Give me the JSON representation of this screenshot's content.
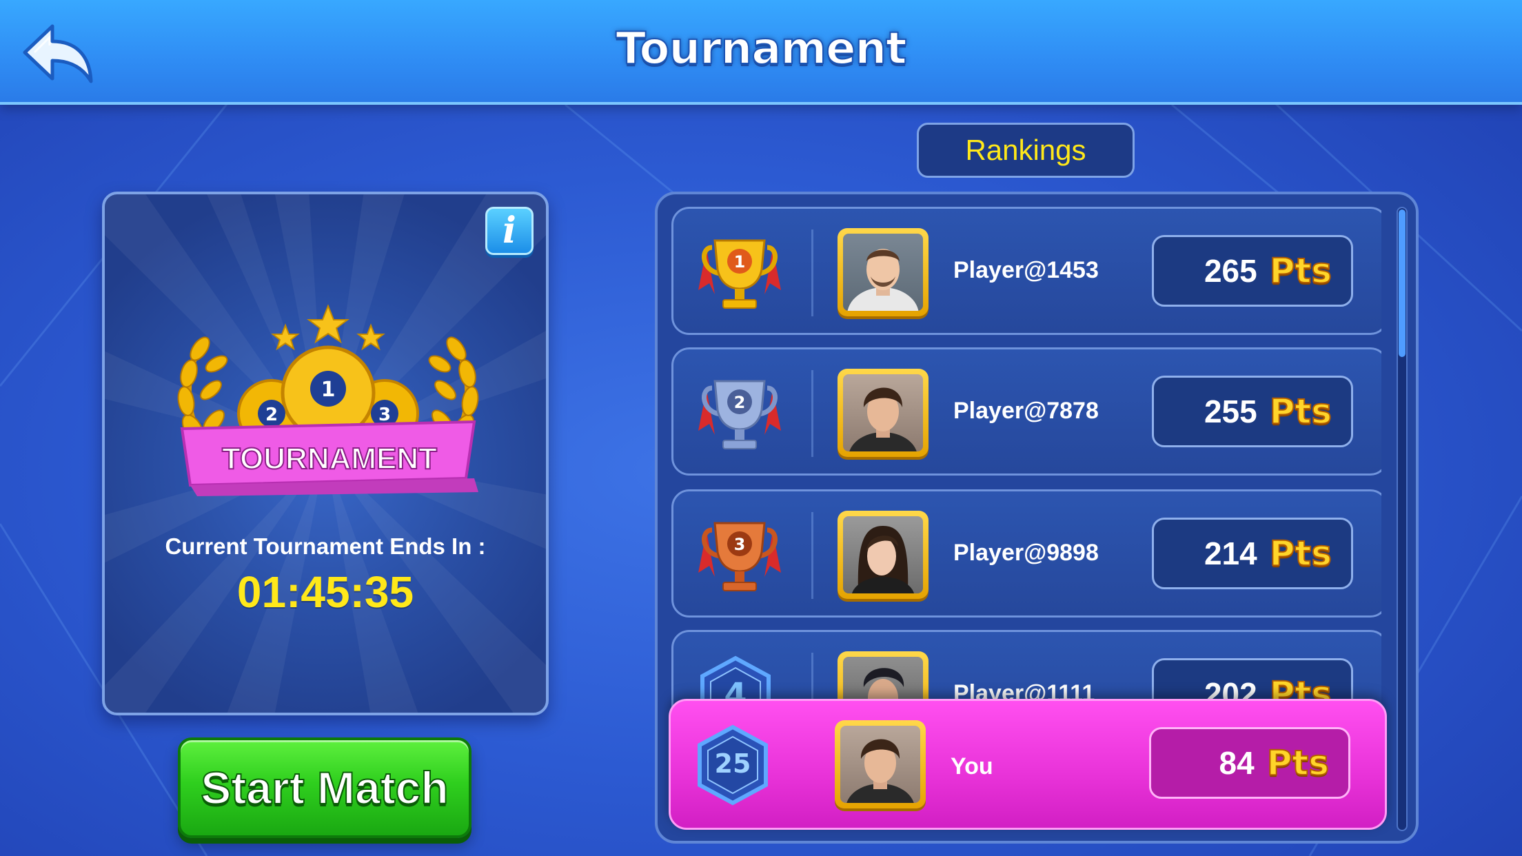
{
  "header": {
    "title": "Tournament"
  },
  "left_panel": {
    "emblem": {
      "medal_numbers": [
        "2",
        "1",
        "3"
      ],
      "banner_text": "TOURNAMENT"
    },
    "ends_label": "Current Tournament Ends In :",
    "timer": "01:45:35"
  },
  "start_button": {
    "label": "Start Match"
  },
  "rankings": {
    "tab_label": "Rankings",
    "rows": [
      {
        "rank": "1",
        "name": "Player@1453",
        "points": "265",
        "pts_label": "Pts"
      },
      {
        "rank": "2",
        "name": "Player@7878",
        "points": "255",
        "pts_label": "Pts"
      },
      {
        "rank": "3",
        "name": "Player@9898",
        "points": "214",
        "pts_label": "Pts"
      },
      {
        "rank": "4",
        "name": "Player@1111",
        "points": "202",
        "pts_label": "Pts"
      }
    ],
    "you": {
      "rank": "25",
      "name": "You",
      "points": "84",
      "pts_label": "Pts"
    }
  },
  "colors": {
    "accent_yellow": "#ffe81a",
    "start_green": "#2fcf1e",
    "you_magenta": "#e832d8",
    "gold": "#f2b705",
    "silver": "#8aa3d8",
    "bronze": "#d9662b"
  },
  "icons": {
    "back": "back-arrow-icon",
    "info": "info-icon",
    "trophy_gold": "gold-trophy-icon",
    "trophy_silver": "silver-trophy-icon",
    "trophy_bronze": "bronze-trophy-icon",
    "rank_badge": "hexagon-rank-badge-icon"
  }
}
